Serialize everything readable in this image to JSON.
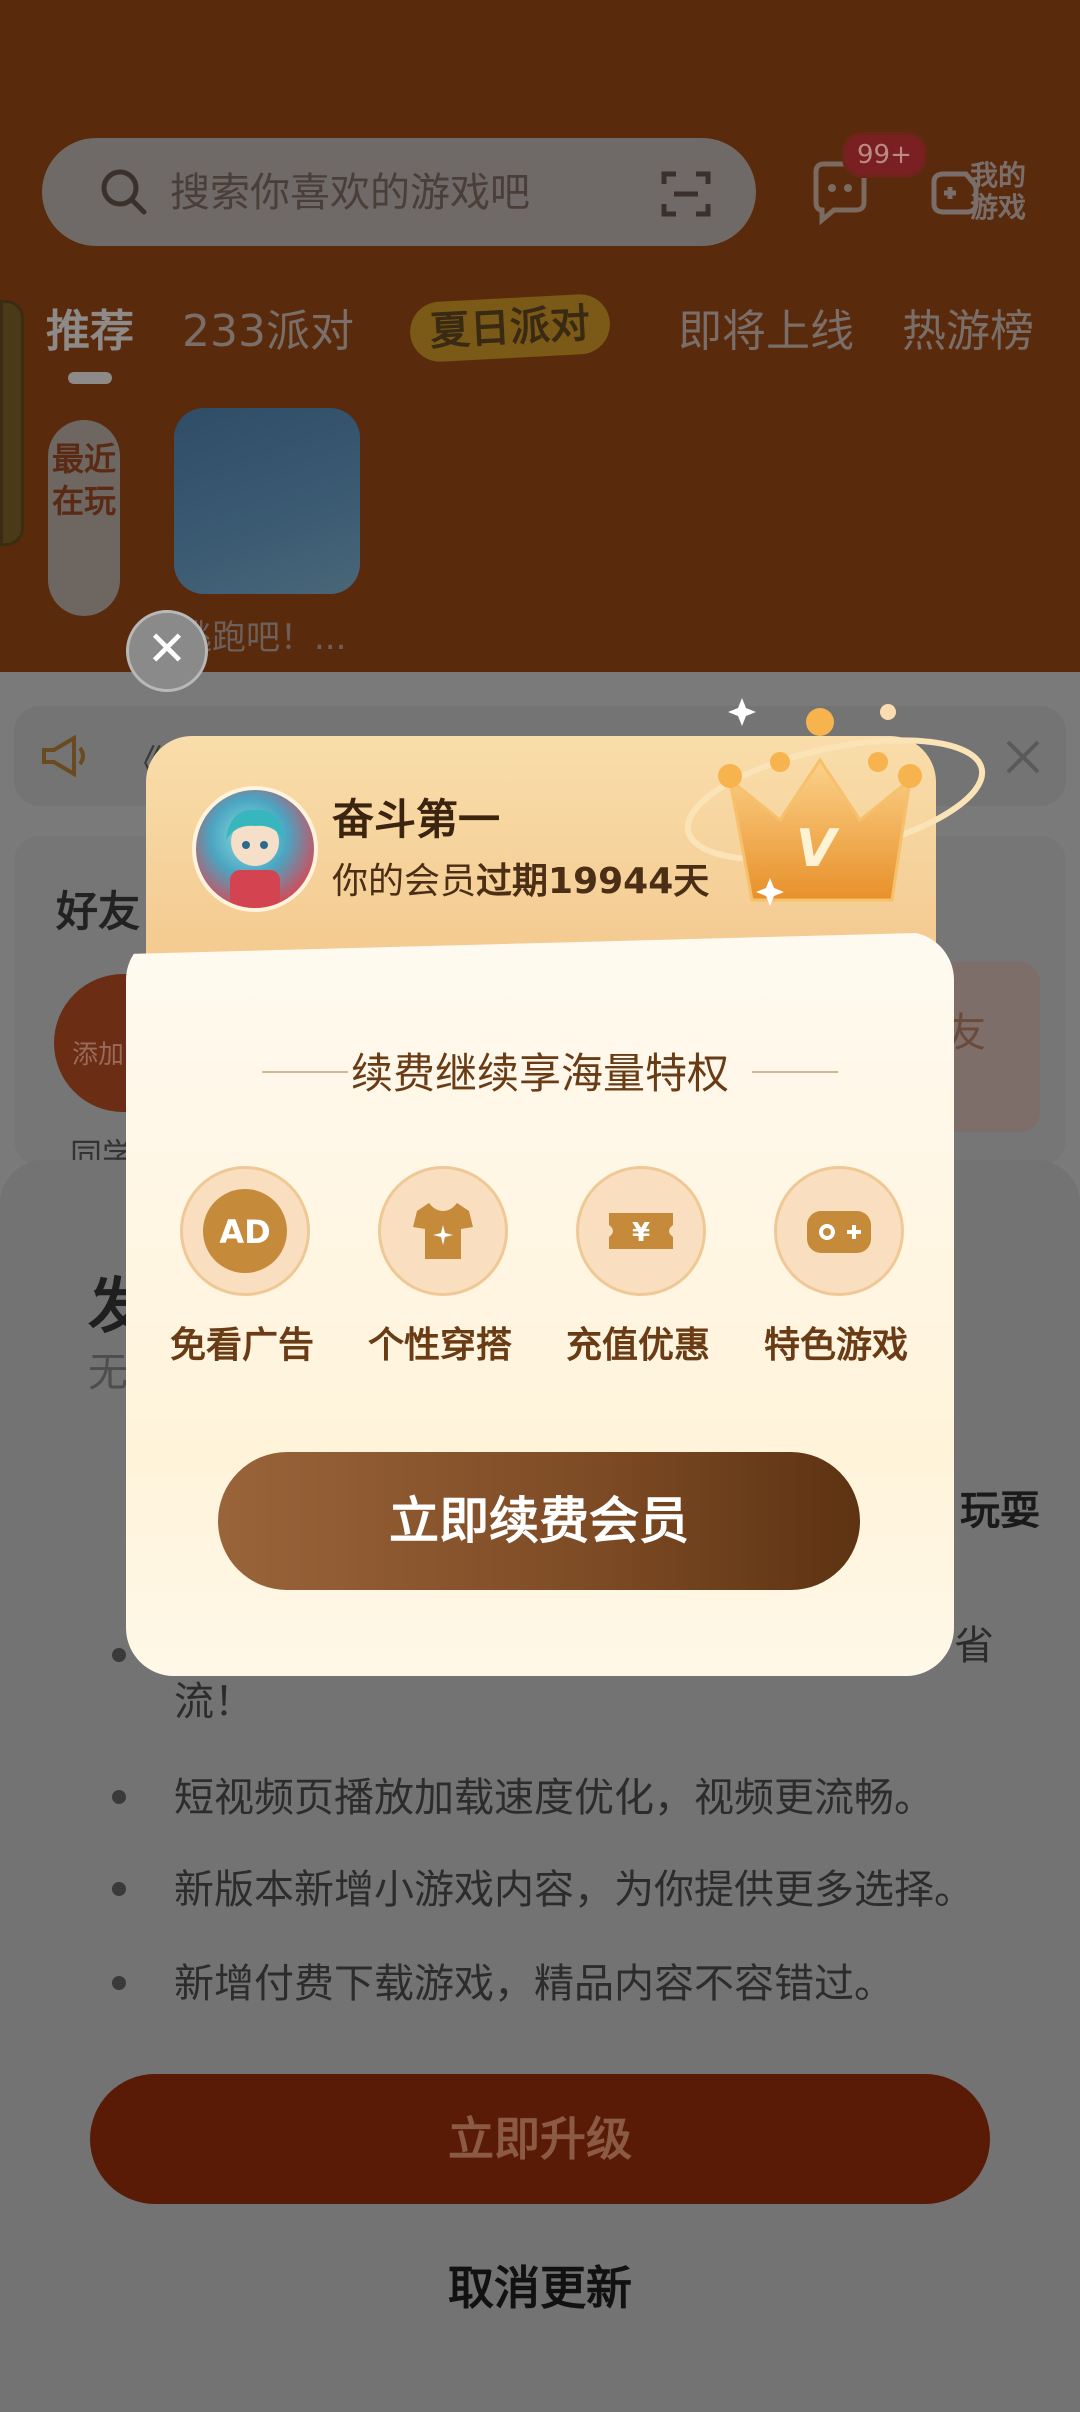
{
  "header": {
    "search_placeholder": "搜索你喜欢的游戏吧",
    "message_badge": "99+",
    "my_games_label": "我的游戏"
  },
  "tabs": [
    {
      "label": "推荐"
    },
    {
      "label": "233派对"
    },
    {
      "label": "夏日派对"
    },
    {
      "label": "即将上线"
    },
    {
      "label": "热游榜"
    }
  ],
  "recent": {
    "label": "最近在玩",
    "game_name": "逃跑吧！..."
  },
  "notice": {
    "text": "《"
  },
  "friends": {
    "title": "好友",
    "add_label": "添加",
    "classmate_label": "同学",
    "right_chip": "友"
  },
  "update": {
    "title": "发",
    "subtitle": "无",
    "headline_tail": "玩耍",
    "bullets": [
      "省流！",
      "短视频页播放加载速度优化，视频更流畅。",
      "新版本新增小游戏内容，为你提供更多选择。",
      "新增付费下载游戏，精品内容不容错过。"
    ],
    "upgrade_label": "立即升级",
    "cancel_label": "取消更新"
  },
  "vip": {
    "username": "奋斗第一",
    "status_prefix": "你的会员",
    "status_bold": "过期19944天",
    "subtitle": "续费继续享海量特权",
    "perks": [
      {
        "label": "免看广告",
        "icon": "ad-icon"
      },
      {
        "label": "个性穿搭",
        "icon": "tshirt-icon"
      },
      {
        "label": "充值优惠",
        "icon": "coupon-icon"
      },
      {
        "label": "特色游戏",
        "icon": "gamepad-icon"
      }
    ],
    "renew_label": "立即续费会员",
    "crown_letter": "V"
  },
  "colors": {
    "accent": "#7c4a24",
    "header_bg": "#5a2a0d",
    "overlay": "#737373"
  }
}
